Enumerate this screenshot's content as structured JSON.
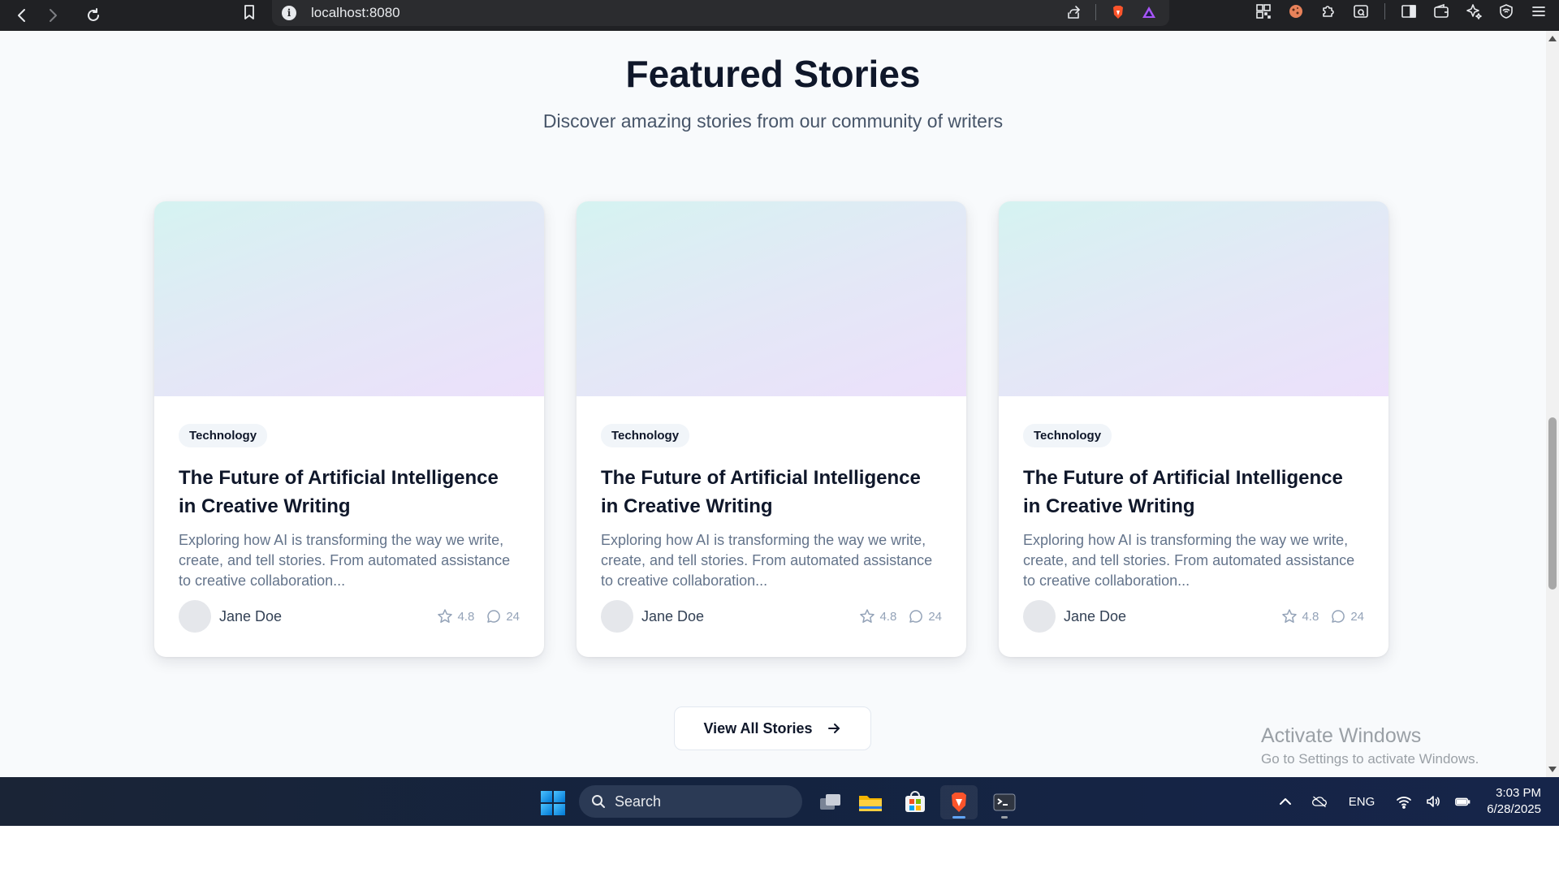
{
  "browser": {
    "url": "localhost:8080",
    "icons": [
      "back-icon",
      "forward-icon",
      "reload-icon",
      "bookmark-icon",
      "info-icon",
      "share-icon",
      "brave-shield-icon",
      "brave-rewards-icon",
      "qr-icon",
      "cookie-icon",
      "extensions-icon",
      "tab-search-icon",
      "sidebar-icon",
      "wallet-icon",
      "leo-ai-icon",
      "vpn-icon",
      "menu-icon"
    ]
  },
  "page": {
    "title": "Featured Stories",
    "subtitle": "Discover amazing stories from our community of writers",
    "cards": [
      {
        "category": "Technology",
        "title": "The Future of Artificial Intelligence in Creative Writing",
        "excerpt": "Exploring how AI is transforming the way we write, create, and tell stories. From automated assistance to creative collaboration...",
        "author": "Jane Doe",
        "rating": "4.8",
        "comments": "24"
      },
      {
        "category": "Technology",
        "title": "The Future of Artificial Intelligence in Creative Writing",
        "excerpt": "Exploring how AI is transforming the way we write, create, and tell stories. From automated assistance to creative collaboration...",
        "author": "Jane Doe",
        "rating": "4.8",
        "comments": "24"
      },
      {
        "category": "Technology",
        "title": "The Future of Artificial Intelligence in Creative Writing",
        "excerpt": "Exploring how AI is transforming the way we write, create, and tell stories. From automated assistance to creative collaboration...",
        "author": "Jane Doe",
        "rating": "4.8",
        "comments": "24"
      }
    ],
    "view_all_label": "View All Stories"
  },
  "watermark": {
    "line1": "Activate Windows",
    "line2": "Go to Settings to activate Windows."
  },
  "taskbar": {
    "search_placeholder": "Search",
    "language": "ENG",
    "time": "3:03 PM",
    "date": "6/28/2025"
  },
  "colors": {
    "page_bg": "#f8fafc",
    "heading": "#0f172a",
    "muted": "#64748b",
    "card_bg": "#ffffff"
  }
}
